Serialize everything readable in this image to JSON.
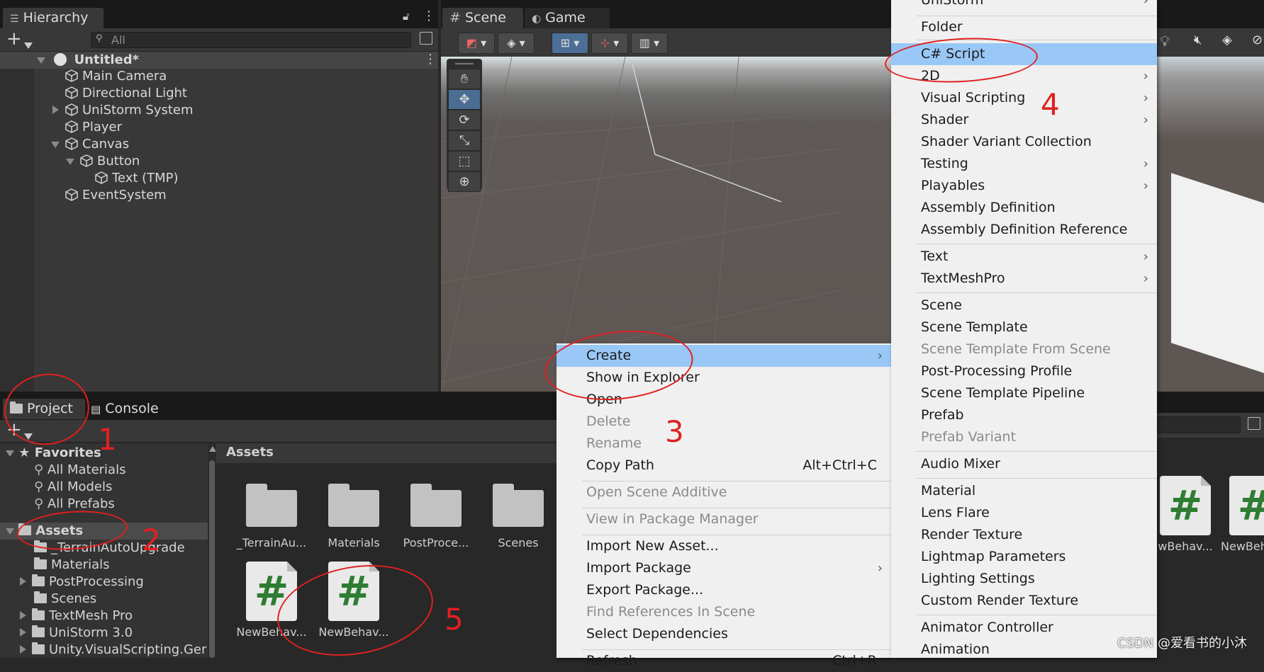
{
  "hierarchy": {
    "tab_label": "Hierarchy",
    "search_placeholder": "All",
    "items": [
      {
        "label": "Untitled*"
      },
      {
        "label": "Main Camera"
      },
      {
        "label": "Directional Light"
      },
      {
        "label": "UniStorm System"
      },
      {
        "label": "Player"
      },
      {
        "label": "Canvas"
      },
      {
        "label": "Button"
      },
      {
        "label": "Text (TMP)"
      },
      {
        "label": "EventSystem"
      }
    ]
  },
  "scene": {
    "tabs": [
      {
        "label": "Scene"
      },
      {
        "label": "Game"
      }
    ]
  },
  "project": {
    "tabs": [
      {
        "label": "Project"
      },
      {
        "label": "Console"
      }
    ],
    "favorites": {
      "label": "Favorites",
      "items": [
        "All Materials",
        "All Models",
        "All Prefabs"
      ]
    },
    "assets": {
      "label": "Assets",
      "items": [
        "_TerrainAutoUpgrade",
        "Materials",
        "PostProcessing",
        "Scenes",
        "TextMesh Pro",
        "UniStorm 3.0",
        "Unity.VisualScripting.Ger"
      ]
    },
    "breadcrumb": "Assets",
    "grid": [
      {
        "label": "_TerrainAu...",
        "kind": "folder"
      },
      {
        "label": "Materials",
        "kind": "folder"
      },
      {
        "label": "PostProce...",
        "kind": "folder"
      },
      {
        "label": "Scenes",
        "kind": "folder"
      },
      {
        "label": "NewBehav...",
        "kind": "script"
      },
      {
        "label": "NewBehav...",
        "kind": "script"
      }
    ],
    "right_grid": [
      "wBehav...",
      "NewBeh"
    ]
  },
  "context_menu": {
    "items": [
      "Create",
      "Show in Explorer",
      "Open",
      "Delete",
      "Rename",
      "Copy Path",
      "Open Scene Additive",
      "View in Package Manager",
      "Import New Asset...",
      "Import Package",
      "Export Package...",
      "Find References In Scene",
      "Select Dependencies",
      "Refresh"
    ],
    "copy_path_shortcut": "Alt+Ctrl+C",
    "refresh_shortcut": "Ctrl+R"
  },
  "create_menu": {
    "items": [
      "UniStorm",
      "Folder",
      "C# Script",
      "2D",
      "Visual Scripting",
      "Shader",
      "Shader Variant Collection",
      "Testing",
      "Playables",
      "Assembly Definition",
      "Assembly Definition Reference",
      "Text",
      "TextMeshPro",
      "Scene",
      "Scene Template",
      "Scene Template From Scene",
      "Post-Processing Profile",
      "Scene Template Pipeline",
      "Prefab",
      "Prefab Variant",
      "Audio Mixer",
      "Material",
      "Lens Flare",
      "Render Texture",
      "Lightmap Parameters",
      "Lighting Settings",
      "Custom Render Texture",
      "Animator Controller",
      "Animation"
    ]
  },
  "annotations": [
    "1",
    "2",
    "3",
    "4",
    "5"
  ],
  "watermark": "CSDN @爱看书的小沐",
  "colors": {
    "highlight": "#99c8f7",
    "annotation": "#e02020",
    "script_icon": "#2e7d32"
  }
}
